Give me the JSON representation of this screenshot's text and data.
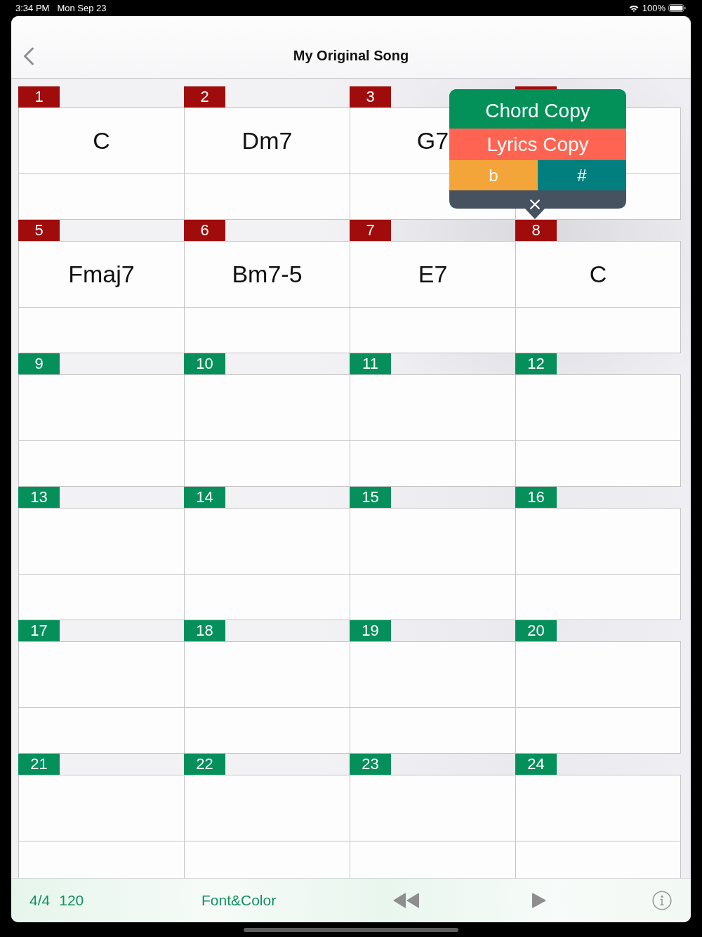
{
  "status_bar": {
    "time": "3:34 PM",
    "date": "Mon Sep 23",
    "battery": "100%"
  },
  "nav": {
    "title": "My Original Song"
  },
  "bars": [
    {
      "number": "1",
      "selected": true,
      "chord": "C"
    },
    {
      "number": "2",
      "selected": true,
      "chord": "Dm7"
    },
    {
      "number": "3",
      "selected": true,
      "chord": "G7"
    },
    {
      "selected": true
    },
    {
      "number": "5",
      "selected": true,
      "chord": "Fmaj7"
    },
    {
      "number": "6",
      "selected": true,
      "chord": "Bm7-5"
    },
    {
      "number": "7",
      "selected": true,
      "chord": "E7"
    },
    {
      "number": "8",
      "selected": true,
      "chord": "C"
    },
    {
      "number": "9",
      "selected": false
    },
    {
      "number": "10",
      "selected": false
    },
    {
      "number": "11",
      "selected": false
    },
    {
      "number": "12",
      "selected": false
    },
    {
      "number": "13",
      "selected": false
    },
    {
      "number": "14",
      "selected": false
    },
    {
      "number": "15",
      "selected": false
    },
    {
      "number": "16",
      "selected": false
    },
    {
      "number": "17",
      "selected": false
    },
    {
      "number": "18",
      "selected": false
    },
    {
      "number": "19",
      "selected": false
    },
    {
      "number": "20",
      "selected": false
    },
    {
      "number": "21",
      "selected": false
    },
    {
      "number": "22",
      "selected": false
    },
    {
      "number": "23",
      "selected": false
    },
    {
      "number": "24",
      "selected": false
    }
  ],
  "popup": {
    "chord_copy": "Chord Copy",
    "lyrics_copy": "Lyrics Copy",
    "flat": "b",
    "sharp": "#"
  },
  "toolbar": {
    "time_signature": "4/4",
    "tempo": "120",
    "font_color": "Font&Color"
  }
}
